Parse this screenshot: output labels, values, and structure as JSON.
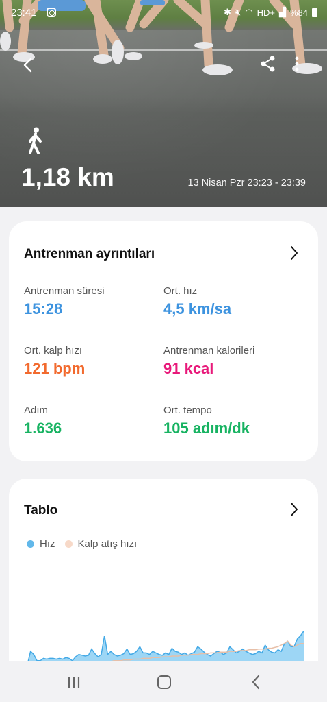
{
  "status_bar": {
    "time": "23:41",
    "hd_label": "HD+",
    "battery": "%84"
  },
  "header": {
    "distance": "1,18 km",
    "datetime": "13 Nisan Pzr 23:23 - 23:39",
    "icons": [
      "back-arrow-icon",
      "share-icon",
      "more-vertical-icon",
      "walk-icon"
    ]
  },
  "details": {
    "title": "Antrenman ayrıntıları",
    "metrics": [
      {
        "label": "Antrenman süresi",
        "value": "15:28",
        "color": "#3d93df"
      },
      {
        "label": "Ort. hız",
        "value": "4,5 km/sa",
        "color": "#3d93df"
      },
      {
        "label": "Ort. kalp hızı",
        "value": "121 bpm",
        "color": "#f26a2e"
      },
      {
        "label": "Antrenman kalorileri",
        "value": "91 kcal",
        "color": "#e8197a"
      },
      {
        "label": "Adım",
        "value": "1.636",
        "color": "#18b362"
      },
      {
        "label": "Ort. tempo",
        "value": "105 adım/dk",
        "color": "#18b362"
      }
    ]
  },
  "chart_section": {
    "title": "Tablo",
    "legend": [
      {
        "name": "Hız",
        "color": "#62b8ea"
      },
      {
        "name": "Kalp atış hızı",
        "color": "#f7d9c8"
      }
    ]
  },
  "chart_data": {
    "type": "area",
    "title": "",
    "series": [
      {
        "name": "Hız",
        "values": [
          0.25,
          0.42,
          0.38,
          0.3,
          0.3,
          0.33,
          0.32,
          0.33,
          0.33,
          0.32,
          0.33,
          0.32,
          0.34,
          0.33,
          0.3,
          0.35,
          0.38,
          0.37,
          0.36,
          0.37,
          0.45,
          0.39,
          0.35,
          0.38,
          0.62,
          0.38,
          0.42,
          0.38,
          0.36,
          0.37,
          0.39,
          0.45,
          0.38,
          0.39,
          0.42,
          0.48,
          0.4,
          0.4,
          0.38,
          0.42,
          0.4,
          0.38,
          0.37,
          0.4,
          0.38,
          0.46,
          0.42,
          0.41,
          0.38,
          0.4,
          0.37,
          0.39,
          0.41,
          0.48,
          0.45,
          0.41,
          0.38,
          0.36,
          0.39,
          0.42,
          0.41,
          0.38,
          0.4,
          0.48,
          0.44,
          0.4,
          0.42,
          0.45,
          0.42,
          0.4,
          0.38,
          0.39,
          0.42,
          0.4,
          0.5,
          0.44,
          0.41,
          0.4,
          0.44,
          0.42,
          0.52,
          0.55,
          0.48,
          0.48,
          0.58,
          0.62,
          0.68
        ]
      },
      {
        "name": "Kalp atış hızı",
        "values": [
          0.05,
          0.07,
          0.09,
          0.12,
          0.14,
          0.16,
          0.18,
          0.19,
          0.2,
          0.2,
          0.21,
          0.22,
          0.22,
          0.23,
          0.23,
          0.24,
          0.24,
          0.25,
          0.25,
          0.26,
          0.26,
          0.27,
          0.27,
          0.28,
          0.28,
          0.29,
          0.29,
          0.3,
          0.3,
          0.3,
          0.31,
          0.31,
          0.31,
          0.32,
          0.32,
          0.32,
          0.33,
          0.33,
          0.33,
          0.34,
          0.34,
          0.34,
          0.35,
          0.35,
          0.35,
          0.36,
          0.36,
          0.36,
          0.37,
          0.37,
          0.37,
          0.38,
          0.38,
          0.38,
          0.39,
          0.39,
          0.39,
          0.4,
          0.4,
          0.4,
          0.41,
          0.41,
          0.41,
          0.42,
          0.42,
          0.42,
          0.43,
          0.43,
          0.43,
          0.44,
          0.44,
          0.44,
          0.45,
          0.45,
          0.45,
          0.46,
          0.46,
          0.47,
          0.48,
          0.5,
          0.52,
          0.55,
          0.5,
          0.48,
          0.5,
          0.52,
          0.52
        ]
      }
    ]
  },
  "navbar": {
    "icons": [
      "recent-apps-icon",
      "home-icon",
      "nav-back-icon"
    ]
  }
}
